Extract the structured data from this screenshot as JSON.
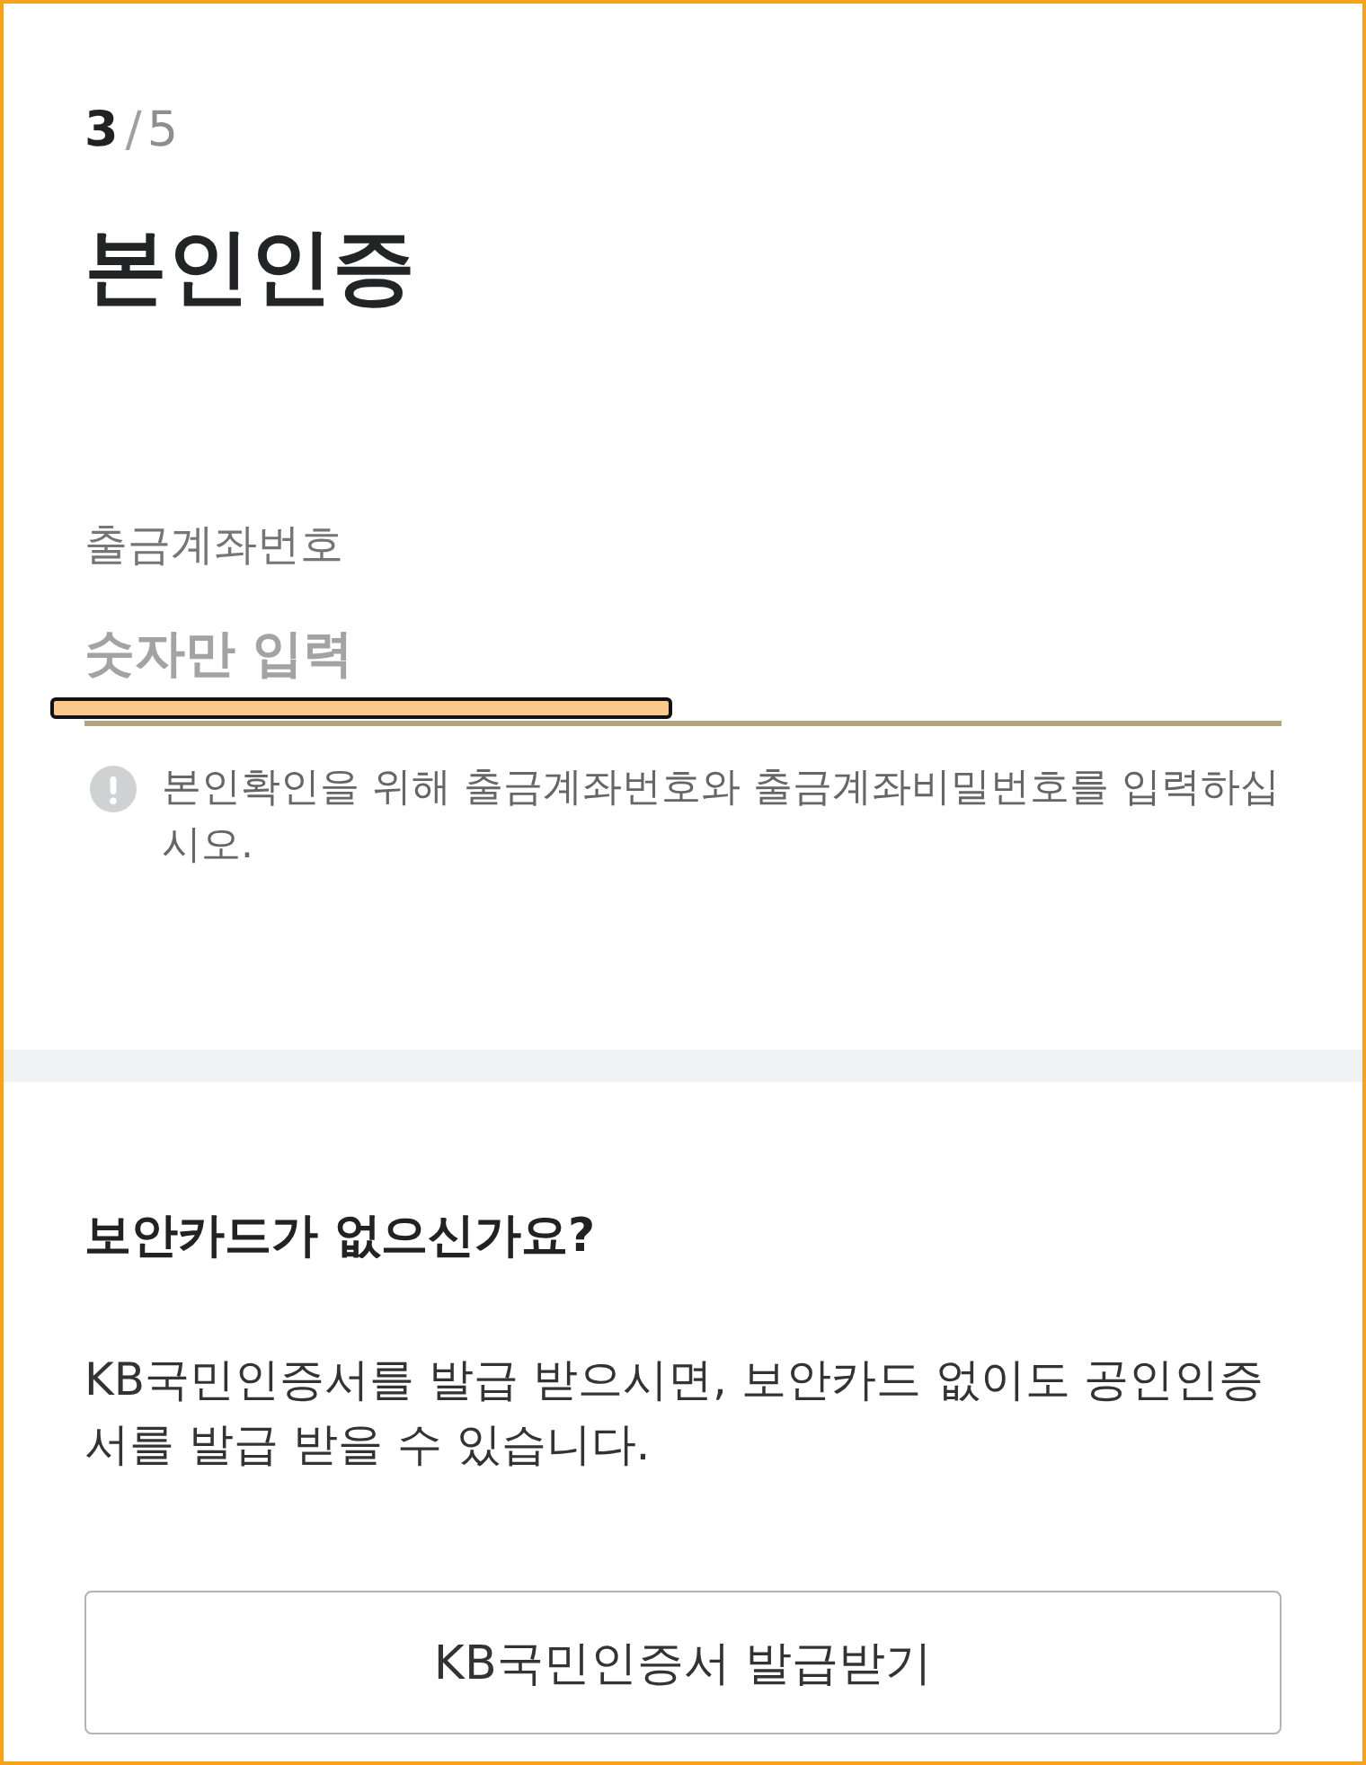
{
  "step": {
    "current": "3",
    "separator": "/",
    "total": "5"
  },
  "title": "본인인증",
  "account_field": {
    "label": "출금계좌번호",
    "placeholder": "숫자만 입력",
    "highlighted": true
  },
  "notice": {
    "text": "본인확인을 위해 출금계좌번호와 출금계좌비밀번호를 입력하십시오."
  },
  "security_card_section": {
    "heading": "보안카드가 없으신가요?",
    "description": "KB국민인증서를 발급 받으시면, 보안카드 없이도 공인인증서를 발급 받을 수 있습니다.",
    "button": "KB국민인증서 발급받기"
  }
}
